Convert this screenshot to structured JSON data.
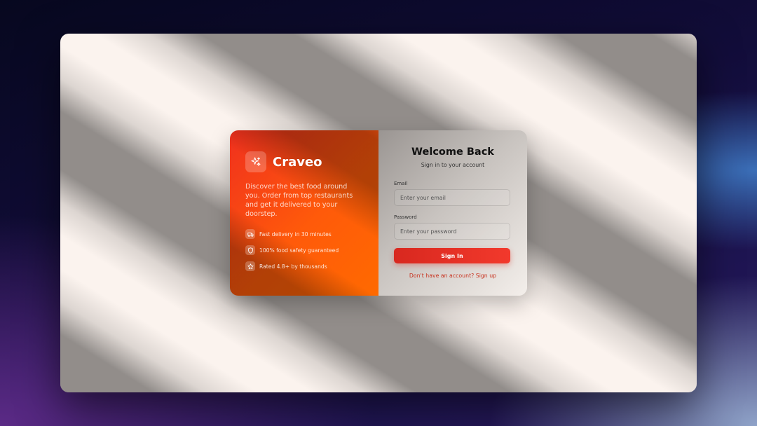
{
  "brand": {
    "name": "Craveo",
    "logo_icon": "sparkles-icon",
    "tagline": "Discover the best food around you. Order from top restaurants and get it delivered to your doorstep.",
    "features": [
      {
        "icon": "truck-icon",
        "text": "Fast delivery in 30 minutes"
      },
      {
        "icon": "shield-icon",
        "text": "100% food safety guaranteed"
      },
      {
        "icon": "star-icon",
        "text": "Rated 4.8+ by thousands"
      }
    ]
  },
  "login": {
    "title": "Welcome Back",
    "subtitle": "Sign in to your account",
    "email_label": "Email",
    "email_placeholder": "Enter your email",
    "password_label": "Password",
    "password_placeholder": "Enter your password",
    "signin_label": "Sign In",
    "signup_text": "Don't have an account? Sign up"
  },
  "colors": {
    "accent": "#f2392c",
    "brand_gradient_start": "#f0301e",
    "brand_gradient_end": "#ff6a00",
    "link": "#c8321f"
  }
}
